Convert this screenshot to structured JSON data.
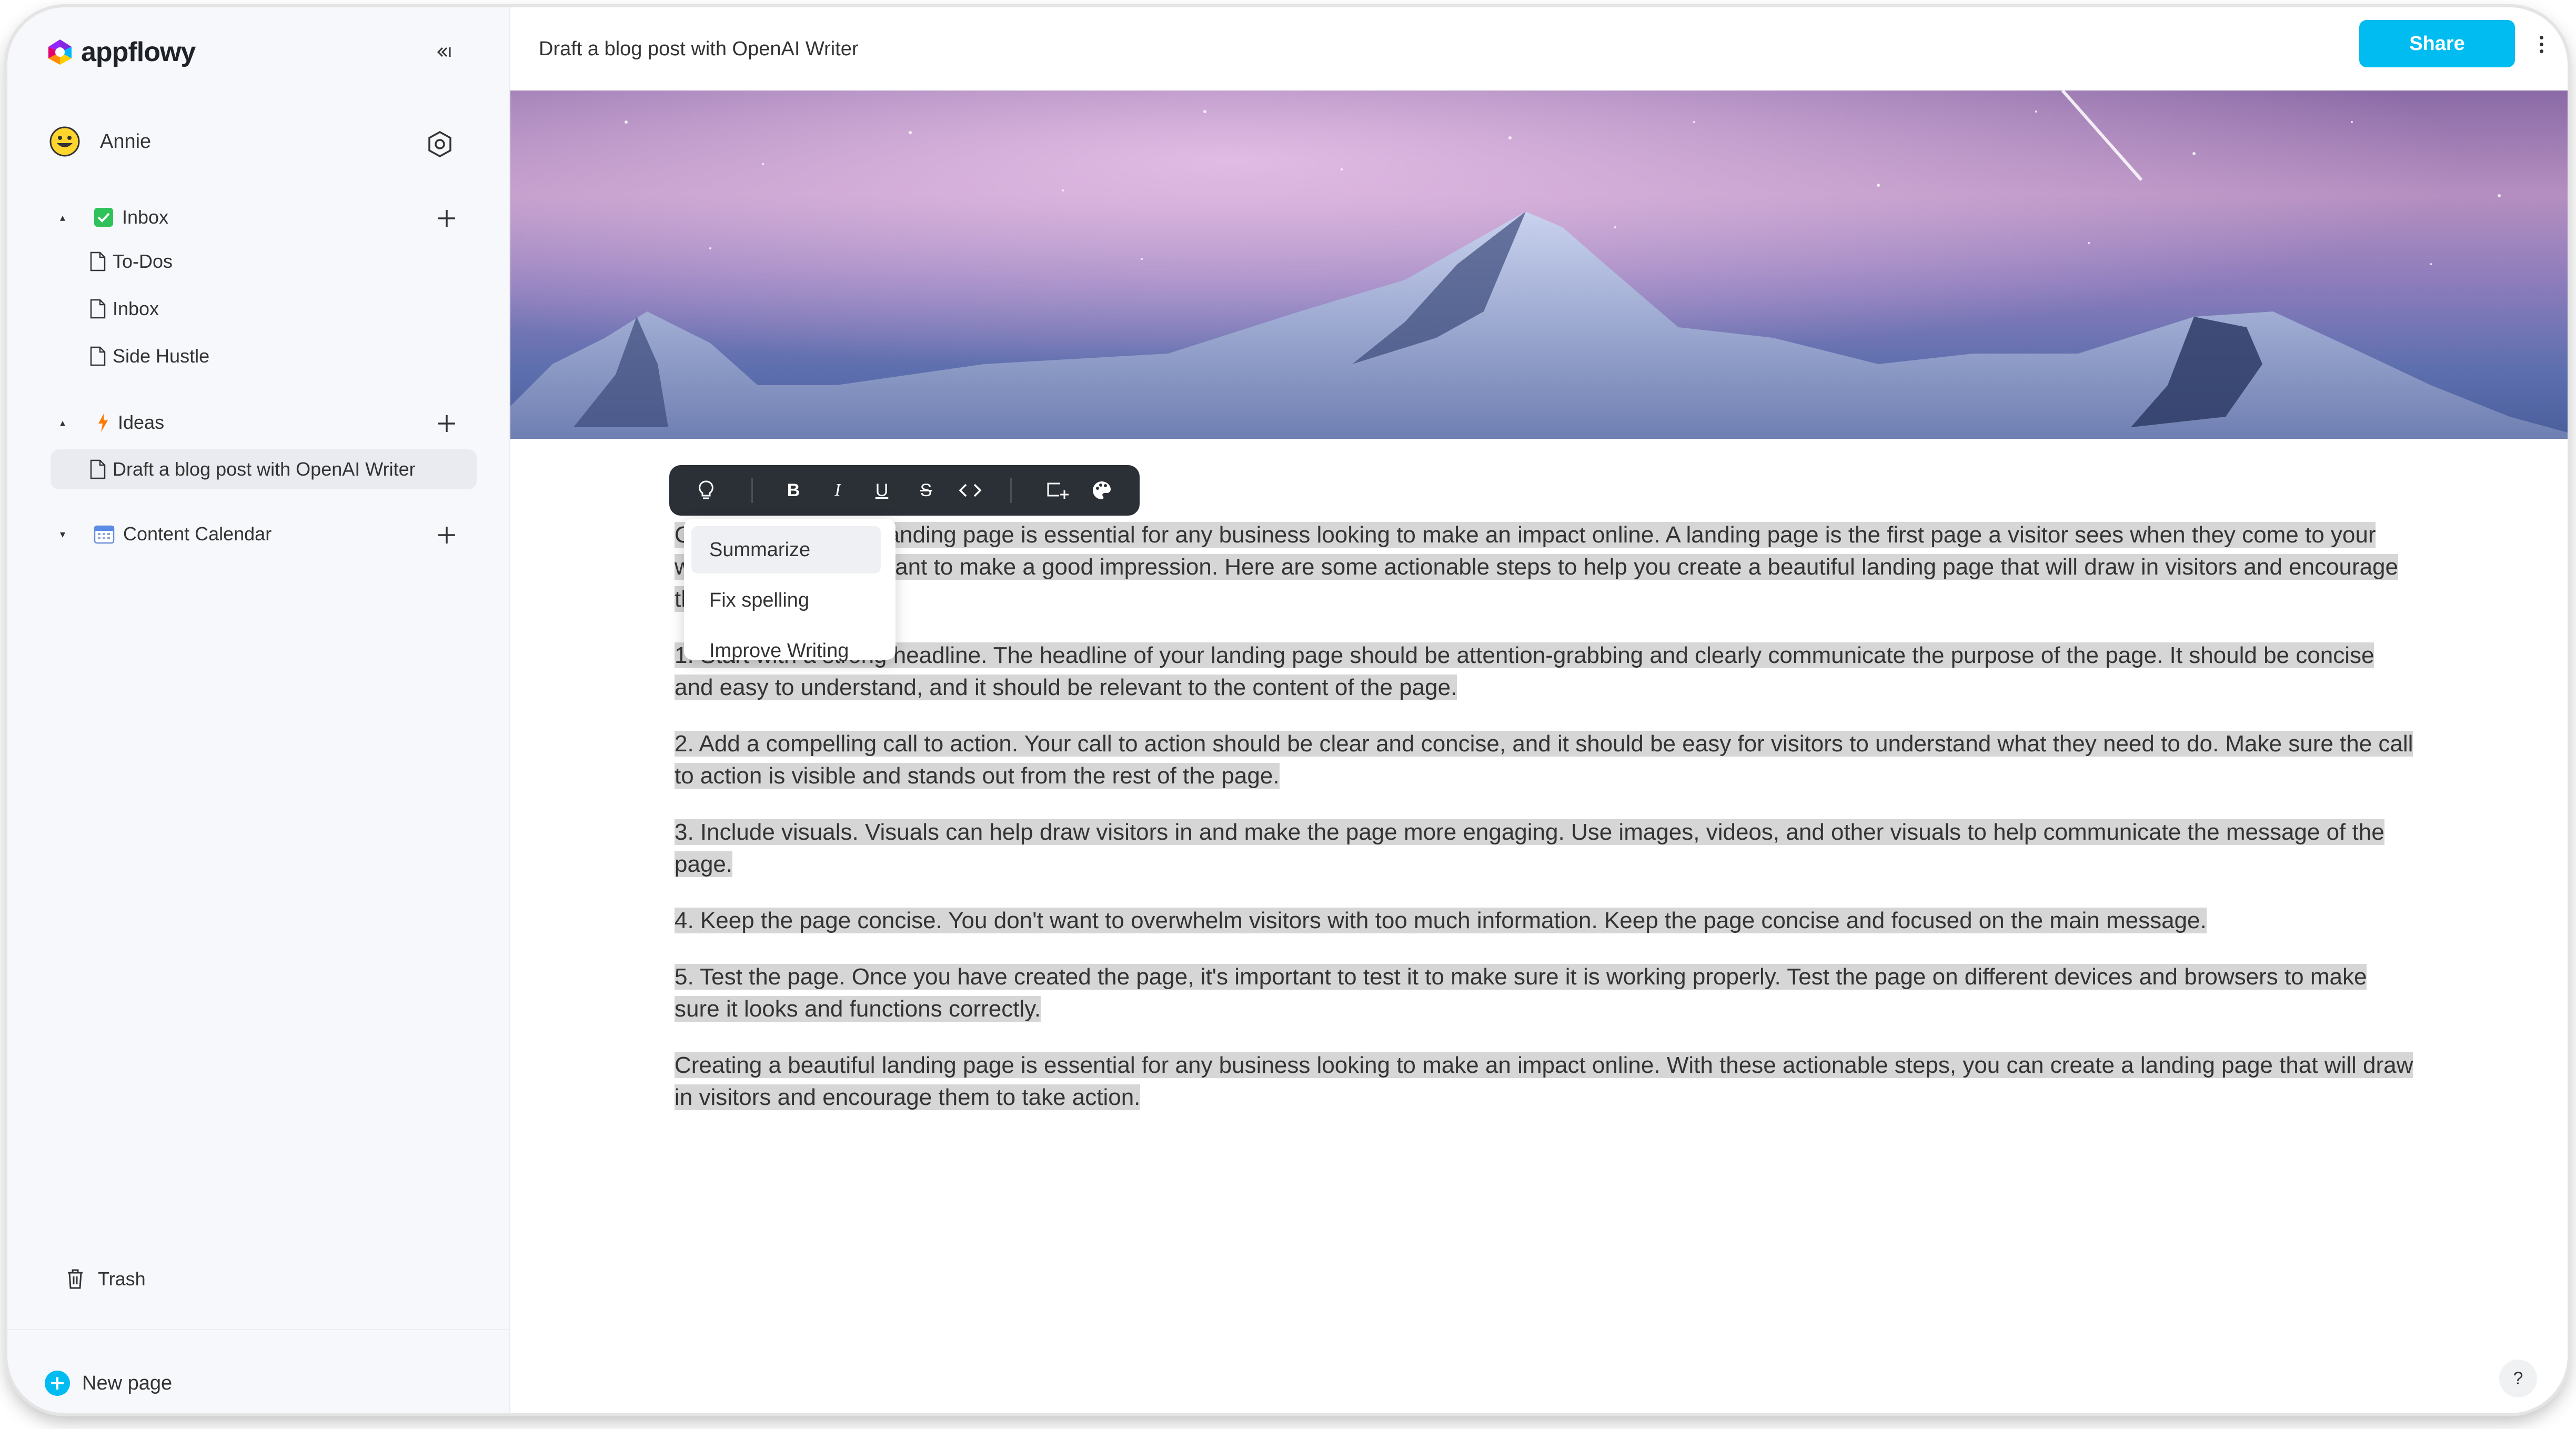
{
  "app": {
    "logo_text": "appflowy",
    "accent_color": "#00bcf0"
  },
  "sidebar": {
    "user": {
      "name": "Annie",
      "avatar_icon": "grinning-face"
    },
    "sections": [
      {
        "label": "Inbox",
        "icon": "checkbox-icon",
        "expanded": true,
        "pages": [
          "To-Dos",
          "Inbox",
          "Side Hustle"
        ]
      },
      {
        "label": "Ideas",
        "icon": "lightning-icon",
        "expanded": true,
        "pages": [
          "Draft a blog post with OpenAI Writer"
        ]
      },
      {
        "label": "Content Calendar",
        "icon": "calendar-icon",
        "expanded": false,
        "pages": []
      }
    ],
    "trash_label": "Trash",
    "new_page_label": "New page"
  },
  "header": {
    "title": "Draft a blog post with OpenAI Writer",
    "share_label": "Share"
  },
  "toolbar": {
    "bold": "B",
    "italic": "I",
    "underline": "U",
    "strike": "S"
  },
  "ai_menu": {
    "items": [
      "Summarize",
      "Fix spelling",
      "Improve Writing"
    ],
    "highlighted": "Summarize"
  },
  "content": {
    "paragraphs": [
      "Creating a beautiful landing page is essential for any business looking to make an impact online. A landing page is the first page a visitor sees when they come to your website, so it's important to make a good impression. Here are some actionable steps to help you create a beautiful landing page that will draw in visitors and encourage them to take action.",
      "1. Start with a strong headline. The headline of your landing page should be attention-grabbing and clearly communicate the purpose of the page. It should be concise and easy to understand, and it should be relevant to the content of the page.",
      "2. Add a compelling call to action. Your call to action should be clear and concise, and it should be easy for visitors to understand what they need to do. Make sure the call to action is visible and stands out from the rest of the page.",
      "3. Include visuals. Visuals can help draw visitors in and make the page more engaging. Use images, videos, and other visuals to help communicate the message of the page.",
      "4. Keep the page concise. You don't want to overwhelm visitors with too much information. Keep the page concise and focused on the main message.",
      "5. Test the page. Once you have created the page, it's important to test it to make sure it is working properly. Test the page on different devices and browsers to make sure it looks and functions correctly.",
      "Creating a beautiful landing page is essential for any business looking to make an impact online. With these actionable steps, you can create a landing page that will draw in visitors and encourage them to take action."
    ],
    "selection_color": "#d6d6d6"
  },
  "help_label": "?"
}
